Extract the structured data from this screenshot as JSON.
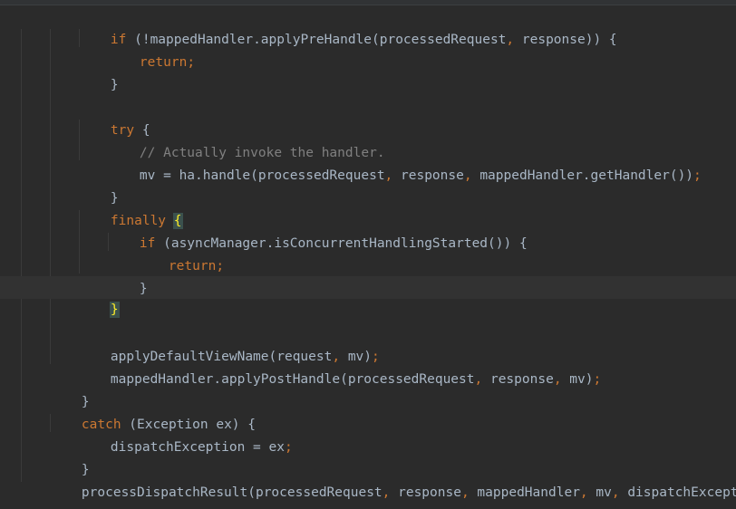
{
  "code": {
    "l1_kw": "if",
    "l1_rest": " (!mappedHandler.applyPreHandle(processedRequest",
    "l1_sep": ",",
    "l1_end": " response)) {",
    "l2_kw": "return",
    "l2_semi": ";",
    "l3": "}",
    "l5_kw": "try",
    "l5_rest": " {",
    "l6_comment": "// Actually invoke the handler.",
    "l7_a": "mv = ha.handle(processedRequest",
    "l7_b": " response",
    "l7_c": " mappedHandler.getHandler())",
    "l7_semi": ";",
    "comma": ",",
    "l8": "}",
    "l9_kw": "finally",
    "l9_brace": "{",
    "l10_kw": "if",
    "l10_rest": " (asyncManager.isConcurrentHandlingStarted()) {",
    "l11_kw": "return",
    "l11_semi": ";",
    "l12": "}",
    "l13_brace": "}",
    "l15_a": "applyDefaultViewName(request",
    "l15_b": " mv)",
    "l15_semi": ";",
    "l16_a": "mappedHandler.applyPostHandle(processedRequest",
    "l16_b": " response",
    "l16_c": " mv)",
    "l16_semi": ";",
    "l17": "}",
    "l18_kw": "catch",
    "l18_rest": " (Exception ex) {",
    "l19_a": "dispatchException = ex",
    "l19_semi": ";",
    "l20": "}",
    "l21_a": "processDispatchResult(processedRequest",
    "l21_b": " response",
    "l21_c": " mappedHandler",
    "l21_d": " mv",
    "l21_e": " dispatchException)",
    "l21_semi": ";",
    "l22": "}"
  },
  "colors": {
    "background": "#2b2b2b",
    "keyword": "#cc7832",
    "comment": "#808080",
    "text": "#a9b7c6",
    "brace_match_bg": "#3b514d",
    "brace_match_fg": "#ffef28",
    "caret_row": "#323232"
  }
}
